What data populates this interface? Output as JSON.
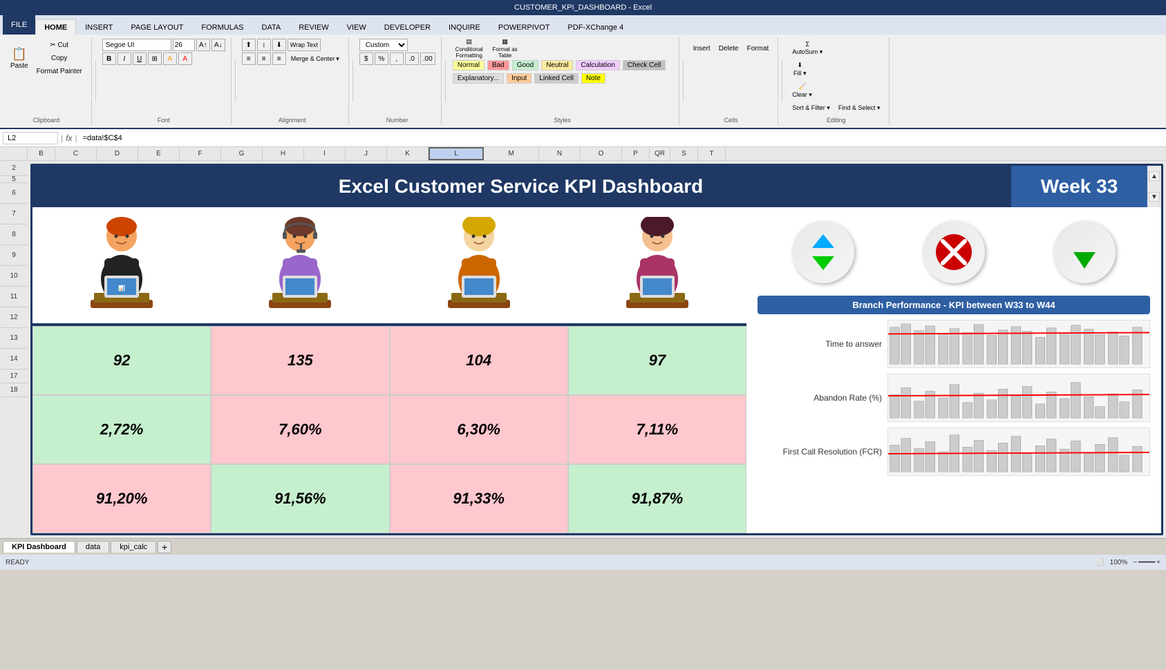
{
  "titlebar": {
    "text": "CUSTOMER_KPI_DASHBOARD - Excel"
  },
  "ribbon": {
    "tabs": [
      "FILE",
      "HOME",
      "INSERT",
      "PAGE LAYOUT",
      "FORMULAS",
      "DATA",
      "REVIEW",
      "VIEW",
      "DEVELOPER",
      "INQUIRE",
      "POWERPIVOT",
      "PDF-XChange 4"
    ],
    "active_tab": "HOME",
    "clipboard_group": "Clipboard",
    "paste_label": "Paste",
    "cut_label": "✂ Cut",
    "copy_label": "Copy",
    "format_painter_label": "Format Painter",
    "font_group": "Font",
    "font_name": "Segoe UI",
    "font_size": "26",
    "bold_label": "B",
    "italic_label": "I",
    "underline_label": "U",
    "alignment_group": "Alignment",
    "merge_center_label": "Merge & Center",
    "wrap_text_label": "Wrap Text",
    "number_group": "Number",
    "number_format": "Custom",
    "styles_group": "Styles",
    "conditional_label": "Conditional Formatting",
    "format_table_label": "Format as Table",
    "normal_label": "Normal",
    "bad_label": "Bad",
    "good_label": "Good",
    "neutral_label": "Neutral",
    "calc_label": "Calculation",
    "check_label": "Check Cell",
    "explanatory_label": "Explanatory...",
    "input_label": "Input",
    "linked_label": "Linked Cell",
    "note_label": "Note",
    "cells_group": "Cells",
    "insert_label": "Insert",
    "delete_label": "Delete",
    "format_label": "Format",
    "editing_group": "Editing",
    "autosum_label": "AutoSum",
    "fill_label": "Fill",
    "clear_label": "Clear ▾",
    "sort_filter_label": "Sort & Filter",
    "find_select_label": "Find & Select"
  },
  "formula_bar": {
    "name_box": "L2",
    "formula": "=data!$C$4",
    "fx": "fx"
  },
  "column_headers": [
    "B",
    "C",
    "D",
    "E",
    "F",
    "G",
    "H",
    "I",
    "J",
    "K",
    "L",
    "M",
    "N",
    "O",
    "P",
    "Q",
    "R",
    "S",
    "T"
  ],
  "row_numbers": [
    "2",
    "5",
    "6",
    "7",
    "8",
    "9",
    "10",
    "11",
    "12",
    "13",
    "14",
    "17",
    "18"
  ],
  "dashboard": {
    "title": "Excel Customer Service KPI Dashboard",
    "week_label": "Week 33",
    "branch_performance_label": "Branch Performance - KPI between W33 to W44",
    "kpi_rows": [
      {
        "values": [
          "92",
          "135",
          "104",
          "97"
        ],
        "colors": [
          "green",
          "pink",
          "pink",
          "green"
        ],
        "label": "Time to answer"
      },
      {
        "values": [
          "2,72%",
          "7,60%",
          "6,30%",
          "7,11%"
        ],
        "colors": [
          "green",
          "pink",
          "pink",
          "pink"
        ],
        "label": "Abandon Rate (%)"
      },
      {
        "values": [
          "91,20%",
          "91,56%",
          "91,33%",
          "91,87%"
        ],
        "colors": [
          "pink",
          "green",
          "pink",
          "green"
        ],
        "label": "First Call Resolution (FCR)"
      }
    ],
    "arrows": [
      {
        "type": "up-down",
        "color_up": "#00aaff",
        "color_down": "#00cc00"
      },
      {
        "type": "x",
        "color": "#cc0000"
      },
      {
        "type": "down",
        "color": "#00aa00"
      }
    ]
  },
  "sheet_tabs": [
    "KPI Dashboard",
    "data",
    "kpi_calc"
  ],
  "active_sheet": "KPI Dashboard",
  "status_bar": {
    "ready": "READY"
  }
}
